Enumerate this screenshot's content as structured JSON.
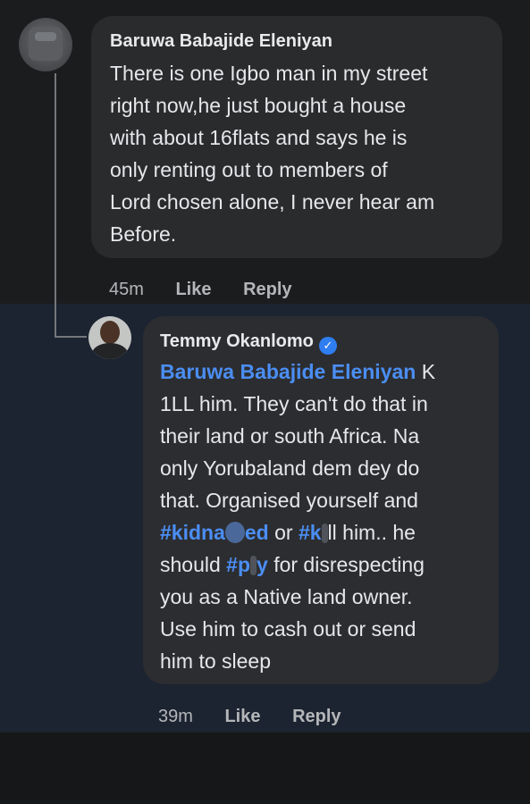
{
  "comments": [
    {
      "author": "Baruwa Babajide Eleniyan",
      "lines": [
        "There is one Igbo man in my street",
        "right now,he just bought a house",
        "with about 16flats and says he is",
        "only renting out to members of",
        "Lord chosen alone, I never hear am",
        "Before."
      ],
      "time": "45m",
      "like_label": "Like",
      "reply_label": "Reply"
    },
    {
      "author": "Temmy Okanlomo",
      "verified_icon": "verified-badge-icon",
      "mention": "Baruwa Babajide Eleniyan",
      "line1_tail": " K",
      "line2": "1LL him. They can't do that in",
      "line3": "their land or south Africa. Na",
      "line4": "only Yorubaland dem dey do",
      "line5": "that. Organised yourself and",
      "hashtag_1_start": "#kidna",
      "hashtag_1_end": "ed",
      "word_or": " or ",
      "hashtag_2_start": "#k",
      "line6_tail": "ll him.. he",
      "line7_start": "should ",
      "hashtag_3_start": "#p",
      "hashtag_3_end": "y",
      "line7_tail": " for disrespecting",
      "line8": "you as a Native land owner.",
      "line9": "Use him to cash out or send",
      "line10": "him to sleep",
      "time": "39m",
      "like_label": "Like",
      "reply_label": "Reply"
    }
  ],
  "colors": {
    "background": "#1b1c1e",
    "reply_band": "#1c2431",
    "bubble": "#2b2c2e",
    "text": "#e6e7ea",
    "link": "#4b8ef3",
    "meta": "#b4b6b9",
    "verified": "#2f7ef1"
  }
}
